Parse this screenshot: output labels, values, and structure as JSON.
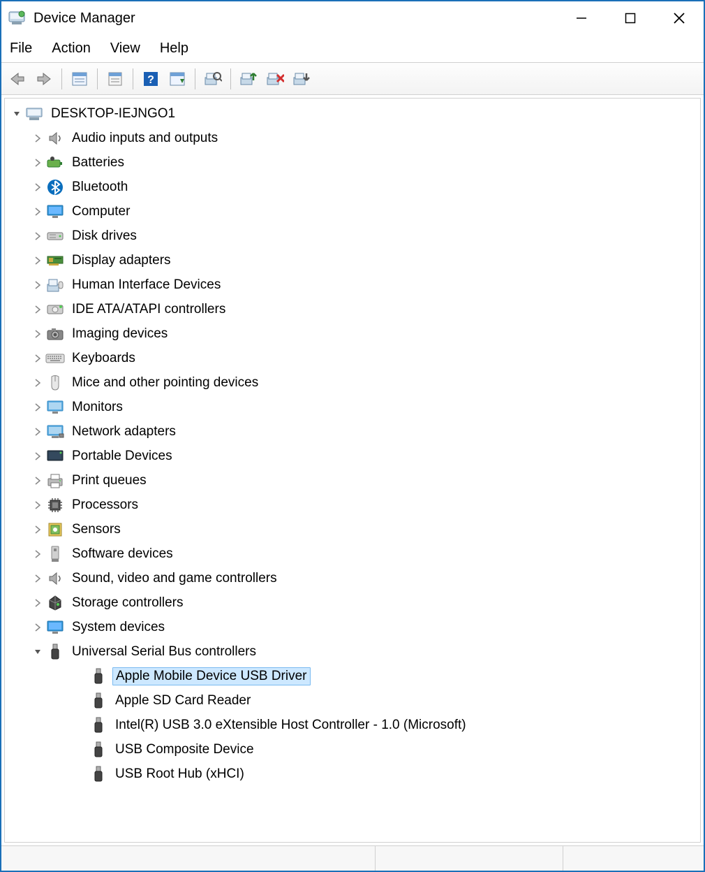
{
  "title": "Device Manager",
  "menu": [
    "File",
    "Action",
    "View",
    "Help"
  ],
  "root": {
    "label": "DESKTOP-IEJNGO1",
    "expanded": true
  },
  "categories": [
    {
      "label": "Audio inputs and outputs",
      "icon": "speaker"
    },
    {
      "label": "Batteries",
      "icon": "battery"
    },
    {
      "label": "Bluetooth",
      "icon": "bluetooth"
    },
    {
      "label": "Computer",
      "icon": "monitor"
    },
    {
      "label": "Disk drives",
      "icon": "disk"
    },
    {
      "label": "Display adapters",
      "icon": "display-card"
    },
    {
      "label": "Human Interface Devices",
      "icon": "hid"
    },
    {
      "label": "IDE ATA/ATAPI controllers",
      "icon": "ide"
    },
    {
      "label": "Imaging devices",
      "icon": "camera"
    },
    {
      "label": "Keyboards",
      "icon": "keyboard"
    },
    {
      "label": "Mice and other pointing devices",
      "icon": "mouse"
    },
    {
      "label": "Monitors",
      "icon": "monitor2"
    },
    {
      "label": "Network adapters",
      "icon": "network"
    },
    {
      "label": "Portable Devices",
      "icon": "portable"
    },
    {
      "label": "Print queues",
      "icon": "printer"
    },
    {
      "label": "Processors",
      "icon": "cpu"
    },
    {
      "label": "Sensors",
      "icon": "sensor"
    },
    {
      "label": "Software devices",
      "icon": "software"
    },
    {
      "label": "Sound, video and game controllers",
      "icon": "speaker"
    },
    {
      "label": "Storage controllers",
      "icon": "storage"
    },
    {
      "label": "System devices",
      "icon": "monitor"
    }
  ],
  "usb_category": {
    "label": "Universal Serial Bus controllers",
    "expanded": true
  },
  "usb_devices": [
    {
      "label": "Apple Mobile Device USB Driver",
      "selected": true
    },
    {
      "label": "Apple SD Card Reader",
      "selected": false
    },
    {
      "label": "Intel(R) USB 3.0 eXtensible Host Controller - 1.0 (Microsoft)",
      "selected": false
    },
    {
      "label": "USB Composite Device",
      "selected": false
    },
    {
      "label": "USB Root Hub (xHCI)",
      "selected": false
    }
  ]
}
